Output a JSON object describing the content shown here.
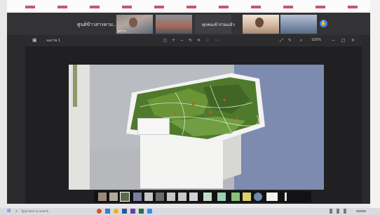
{
  "meeting": {
    "title": "ศูนย์ข้าวสารคาม...",
    "participants": [
      {
        "caption": "ผู้เข้าร่วม"
      },
      {
        "caption": ""
      },
      {
        "caption": ""
      },
      {
        "caption": ""
      },
      {
        "caption": ""
      }
    ],
    "banner_text": "ทุกคนเข้าร่วมแล้ว"
  },
  "share_window": {
    "title": "จอภาพ 1",
    "zoom": "100%"
  },
  "taskbar": {
    "search_placeholder": "Type here to search"
  },
  "colors": {
    "accent_blue": "#3c82f0",
    "ticks": "#c9566a"
  }
}
